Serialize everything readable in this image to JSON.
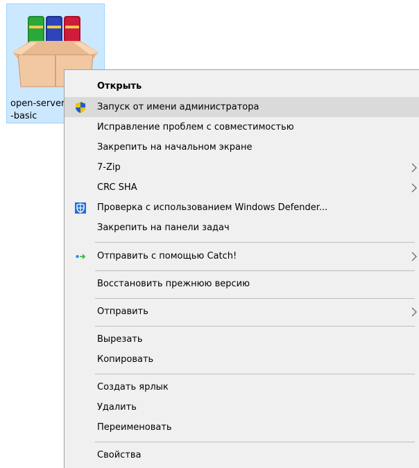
{
  "desktop_icon": {
    "label": "open-server\n-basic",
    "icon": "winrar-archive-icon"
  },
  "context_menu": {
    "items": [
      {
        "label": "Открыть",
        "bold": true
      },
      {
        "label": "Запуск от имени администратора",
        "icon": "uac-shield-icon",
        "highlighted": true
      },
      {
        "label": "Исправление проблем с совместимостью"
      },
      {
        "label": "Закрепить на начальном экране"
      },
      {
        "label": "7-Zip",
        "submenu": true
      },
      {
        "label": "CRC SHA",
        "submenu": true
      },
      {
        "label": "Проверка с использованием Windows Defender...",
        "icon": "windows-defender-icon"
      },
      {
        "label": "Закрепить на панели задач"
      },
      {
        "label": "Отправить с помощью Catch!",
        "icon": "catch-icon",
        "submenu": true
      },
      {
        "label": "Восстановить прежнюю версию"
      },
      {
        "label": "Отправить",
        "submenu": true
      },
      {
        "label": "Вырезать"
      },
      {
        "label": "Копировать"
      },
      {
        "label": "Создать ярлык"
      },
      {
        "label": "Удалить"
      },
      {
        "label": "Переименовать"
      },
      {
        "label": "Свойства"
      }
    ]
  }
}
